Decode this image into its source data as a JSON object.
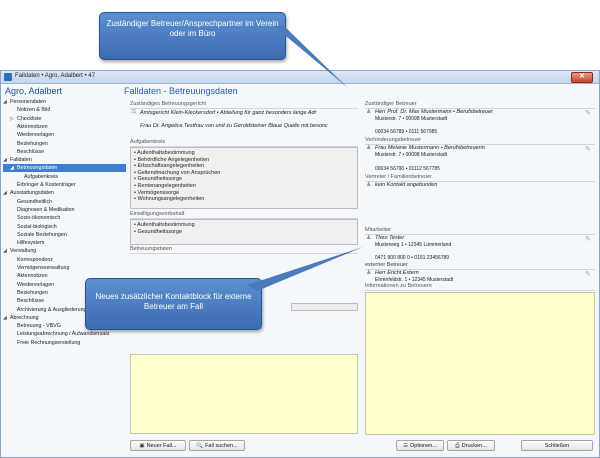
{
  "window": {
    "title": "Falldaten • Agro, Adalbert • 47",
    "close": "✕"
  },
  "client_name": "Agro, Adalbert",
  "main_title": "Falldaten - Betreuungsdaten",
  "sidebar": [
    {
      "label": "Personendaten",
      "toggle": "◢",
      "indent": 0
    },
    {
      "label": "Notizen & Bild",
      "toggle": "",
      "indent": 1
    },
    {
      "label": "Checkliste",
      "toggle": "▷",
      "indent": 1
    },
    {
      "label": "Aktennotizen",
      "toggle": "",
      "indent": 1
    },
    {
      "label": "Wiedervorlagen",
      "toggle": "",
      "indent": 1
    },
    {
      "label": "Beziehungen",
      "toggle": "",
      "indent": 1
    },
    {
      "label": "Beschlüsse",
      "toggle": "",
      "indent": 1
    },
    {
      "label": "Falldaten",
      "toggle": "◢",
      "indent": 0
    },
    {
      "label": "Betreuungsdaten",
      "toggle": "◢",
      "indent": 1,
      "selected": true
    },
    {
      "label": "Aufgabenkreis",
      "toggle": "",
      "indent": 2
    },
    {
      "label": "Erbringer & Kostenträger",
      "toggle": "",
      "indent": 1
    },
    {
      "label": "Ausstattungsdaten",
      "toggle": "◢",
      "indent": 0
    },
    {
      "label": "Gesundheitlich",
      "toggle": "",
      "indent": 1
    },
    {
      "label": "Diagnosen & Medikation",
      "toggle": "",
      "indent": 1
    },
    {
      "label": "Sozio-ökonomisch",
      "toggle": "",
      "indent": 1
    },
    {
      "label": "Sozial-biologisch",
      "toggle": "",
      "indent": 1
    },
    {
      "label": "Soziale Beziehungen",
      "toggle": "",
      "indent": 1
    },
    {
      "label": "Hilfesystem",
      "toggle": "",
      "indent": 1
    },
    {
      "label": "Verwaltung",
      "toggle": "◢",
      "indent": 0
    },
    {
      "label": "Korrespondenz",
      "toggle": "",
      "indent": 1
    },
    {
      "label": "Vermögensverwaltung",
      "toggle": "",
      "indent": 1
    },
    {
      "label": "Aktennotizen",
      "toggle": "",
      "indent": 1
    },
    {
      "label": "Wiedervorlagen",
      "toggle": "",
      "indent": 1
    },
    {
      "label": "Beziehungen",
      "toggle": "",
      "indent": 1
    },
    {
      "label": "Beschlüsse",
      "toggle": "",
      "indent": 1
    },
    {
      "label": "Archivierung & Ausgliederung",
      "toggle": "",
      "indent": 1
    },
    {
      "label": "Abrechnung",
      "toggle": "◢",
      "indent": 0
    },
    {
      "label": "Betreuung - VBVG",
      "toggle": "",
      "indent": 1
    },
    {
      "label": "Leistungsabrechnung / Aufwandsersatz",
      "toggle": "",
      "indent": 1
    },
    {
      "label": "Freie Rechnungserstellung",
      "toggle": "",
      "indent": 1
    }
  ],
  "court": {
    "header": "Zuständiges Betreuungsgericht",
    "name": "Amtsgericht Klein-Kleckersdorf • Abteilung für ganz besonders lange Adr",
    "judge": "Frau Dr. Angelica Testfrau von und zu Geroldsteiner Blaue Quelle mit besonc"
  },
  "aufgabenkreis": {
    "header": "Aufgabenkreis",
    "items": [
      "• Aufenthaltsbestimmung",
      "• Behördliche Angelegenheiten",
      "• Erbschaftsangelegenheiten",
      "• Geltendmachung von Ansprüchen",
      "• Gesundheitssorge",
      "• Rentenangelegenheiten",
      "• Vermögenssorge",
      "• Wohnungsangelegenheiten"
    ]
  },
  "einwilligung": {
    "header": "Einwilligungsvorbehalt",
    "items": [
      "• Aufenthaltsbestimmung",
      "• Gesundheitssorge"
    ]
  },
  "betreuungsdaten_header": "Betreuungsdaten",
  "betreuer": {
    "header": "Zuständiger Betreuer",
    "name": "Herr Prof. Dr. Max Mustermann • Berufsbetreuer",
    "address": "Musterstr. 7 • 00098 Musterstadt",
    "phone": "00034 56789 • 0111 567985"
  },
  "verhinderung": {
    "header": "Verhinderungsbetreuer",
    "name": "Frau Melanie Mustermann • Berufsbetreuerin",
    "address": "Musterstr. 7 • 00098 Musterstadt",
    "phone": "00034 56790 • 01112 567785"
  },
  "vertreter": {
    "header": "Vertreter / Familienbetreuer",
    "link": "kein Kontakt angebunden"
  },
  "mitarbeiter": {
    "header": "Mitarbeiter",
    "name": "Theo Tester",
    "address": "Musterweg 1 • 12345 Lümmerland",
    "phone": "0471 900 800 0 • 0151 23456789"
  },
  "extern": {
    "header": "externer Betreuer",
    "name": "Herr Ericht Extern",
    "address": "Ehrenfeldstr. 1 • 12345 Musterstadt"
  },
  "info_header": "Informationen zu Betreuern",
  "buttons": {
    "new_case": "Neuer Fall...",
    "search_case": "Fall suchen...",
    "options": "Optionen...",
    "print": "Drucken...",
    "close": "Schließen"
  },
  "callouts": {
    "top": "Zuständiger Betreuer/Ansprechpartner im Verein oder im Büro",
    "bottom": "Neues zusätzlicher Kontaktblock für externe Betreuer am Fall"
  }
}
